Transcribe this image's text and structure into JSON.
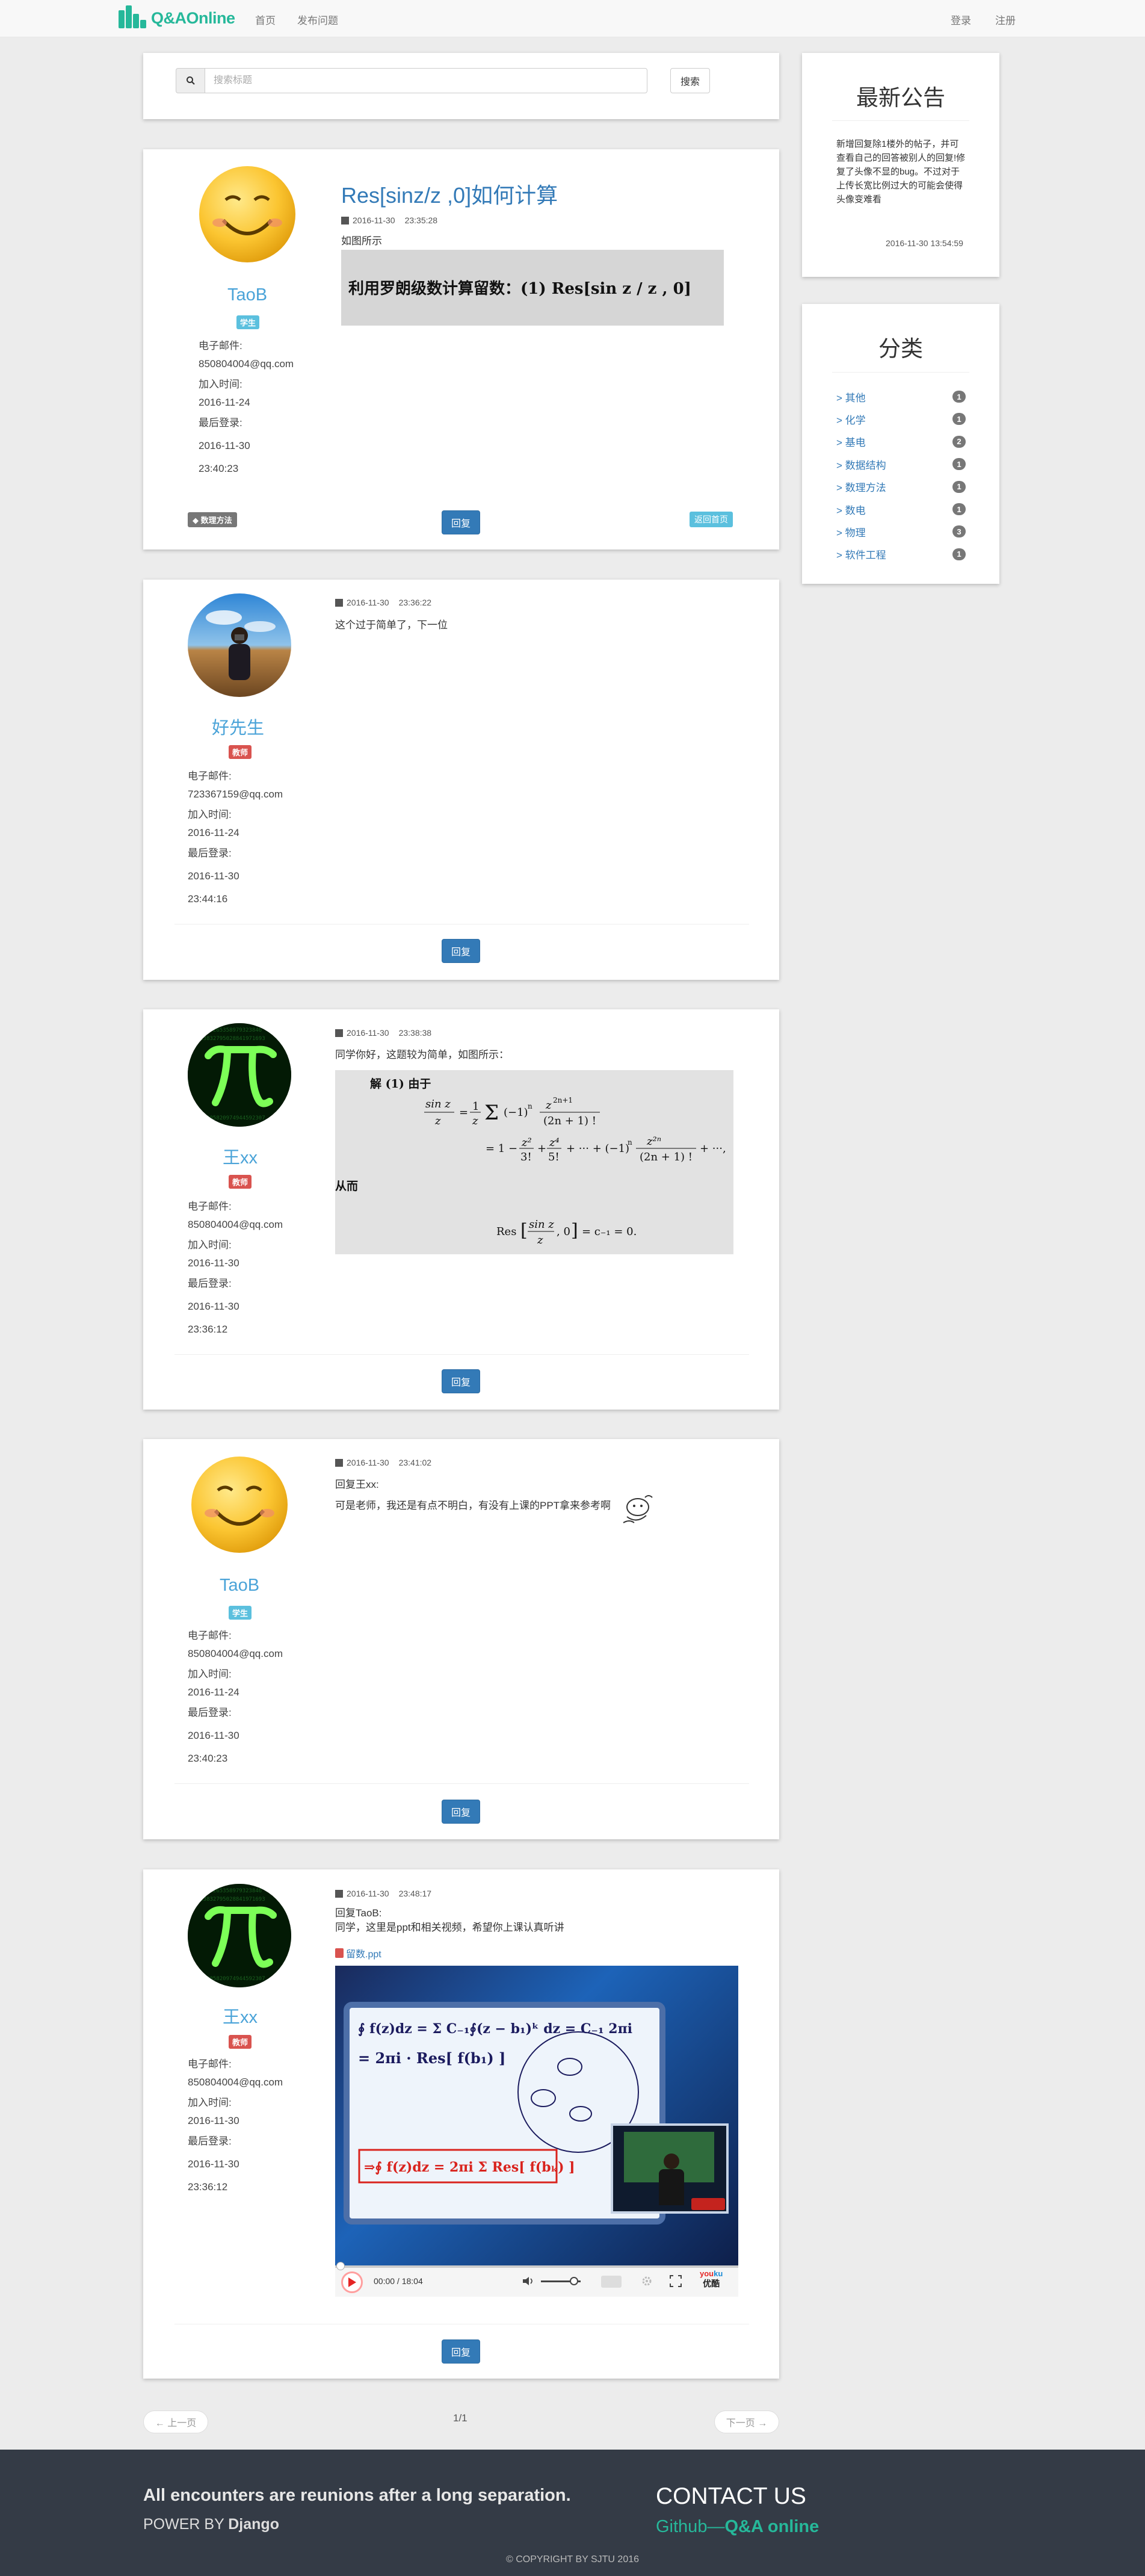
{
  "nav": {
    "logo_text": "Q&AOnline",
    "home": "首页",
    "ask": "发布问题",
    "login": "登录",
    "register": "注册"
  },
  "search": {
    "placeholder": "搜索标题",
    "submit": "搜索"
  },
  "question": {
    "title": "Res[sinz/z ,0]如何计算",
    "date": "2016-11-30",
    "time": "23:35:28",
    "body": "如图所示",
    "formula": "利用罗朗级数计算留数：(1) Res[sin z / z , 0]",
    "tag": "数理方法",
    "back_label": "返回首页",
    "reply_label": "回复"
  },
  "labels": {
    "email": "电子邮件:",
    "joined": "加入时间:",
    "last_login": "最后登录:"
  },
  "posts": [
    {
      "user": "TaoB",
      "role": "学生",
      "email": "850804004@qq.com",
      "joined": "2016-11-24",
      "last_date": "2016-11-30",
      "last_time": "23:40:23"
    },
    {
      "user": "好先生",
      "role": "教师",
      "email": "723367159@qq.com",
      "joined": "2016-11-24",
      "last_date": "2016-11-30",
      "last_time": "23:44:16",
      "date": "2016-11-30",
      "time": "23:36:22",
      "body": "这个过于简单了，下一位"
    },
    {
      "user": "王xx",
      "role": "教师",
      "email": "850804004@qq.com",
      "joined": "2016-11-30",
      "last_date": "2016-11-30",
      "last_time": "23:36:12",
      "date": "2016-11-30",
      "time": "23:38:38",
      "body": "同学你好，这题较为简单，如图所示：",
      "img_line1": "解  (1) 由于",
      "img_line2": "从而"
    },
    {
      "user": "TaoB",
      "role": "学生",
      "email": "850804004@qq.com",
      "joined": "2016-11-24",
      "last_date": "2016-11-30",
      "last_time": "23:40:23",
      "date": "2016-11-30",
      "time": "23:41:02",
      "body1": "回复王xx:",
      "body2": "可是老师，我还是有点不明白，有没有上课的PPT拿来参考啊"
    },
    {
      "user": "王xx",
      "role": "教师",
      "email": "850804004@qq.com",
      "joined": "2016-11-30",
      "last_date": "2016-11-30",
      "last_time": "23:36:12",
      "date": "2016-11-30",
      "time": "23:48:17",
      "body1": "回复TaoB:",
      "body2": "同学，这里是ppt和相关视频，希望你上课认真听讲",
      "attachment": "留数.ppt",
      "video_time": "00:00 / 18:04",
      "video_brand": "优酷"
    }
  ],
  "sidebar": {
    "notice_title": "最新公告",
    "notice_body": "新增回复除1楼外的帖子，并可查看自己的回答被别人的回复!修复了头像不显的bug。不过对于上传长宽比例过大的可能会使得头像变难看",
    "notice_time": "2016-11-30 13:54:59",
    "category_title": "分类",
    "categories": [
      {
        "name": "> 其他",
        "count": "1"
      },
      {
        "name": "> 化学",
        "count": "1"
      },
      {
        "name": "> 基电",
        "count": "2"
      },
      {
        "name": "> 数据结构",
        "count": "1"
      },
      {
        "name": "> 数理方法",
        "count": "1"
      },
      {
        "name": "> 数电",
        "count": "1"
      },
      {
        "name": "> 物理",
        "count": "3"
      },
      {
        "name": "> 软件工程",
        "count": "1"
      }
    ]
  },
  "pager": {
    "prev": "← 上一页",
    "page": "1/1",
    "next": "下一页 →"
  },
  "footer": {
    "slogan": "All encounters are reunions after a long separation.",
    "power_prefix": "POWER BY ",
    "power_name": "Django",
    "contact": "CONTACT US",
    "github_prefix": "Github—",
    "github_name": "Q&A online",
    "copyright": "© COPYRIGHT BY SJTU 2016"
  }
}
